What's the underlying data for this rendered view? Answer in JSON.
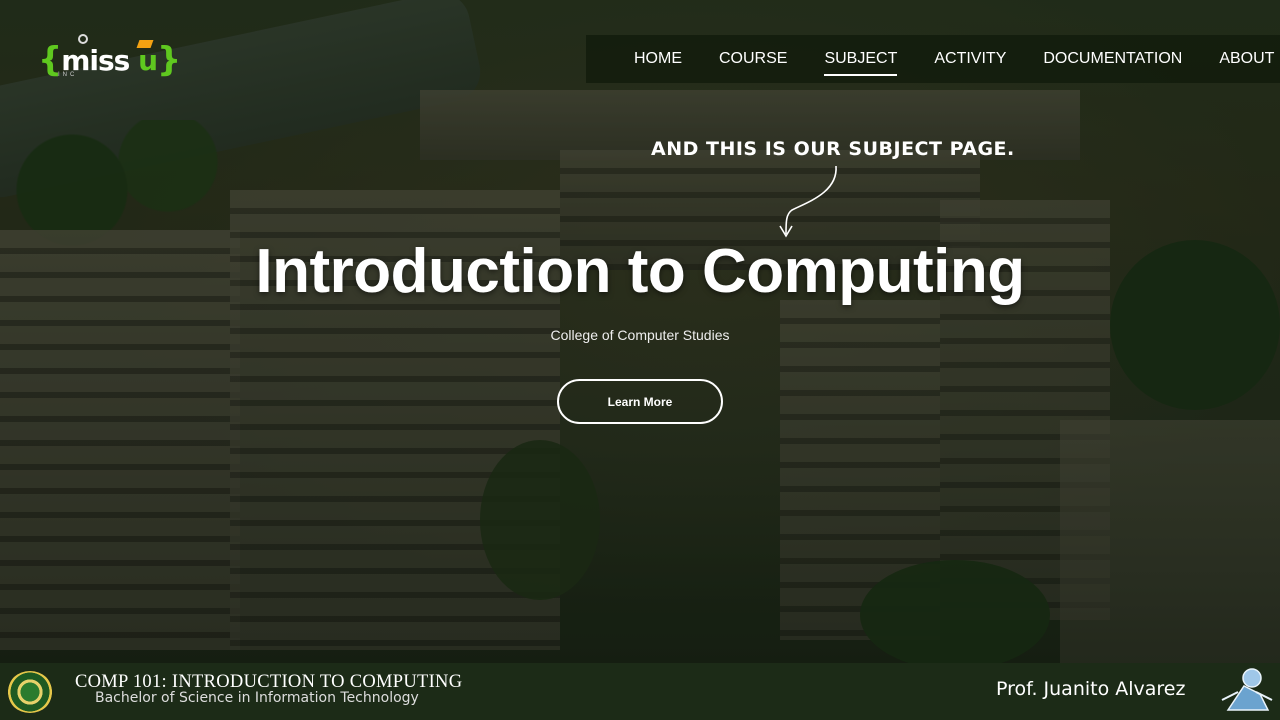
{
  "logo": {
    "brand": "miss u",
    "sub": "INC"
  },
  "nav": {
    "items": [
      "HOME",
      "COURSE",
      "SUBJECT",
      "ACTIVITY",
      "DOCUMENTATION",
      "ABOUT"
    ],
    "active": "SUBJECT"
  },
  "hero": {
    "annotation": "AND THIS IS OUR SUBJECT PAGE.",
    "title": "Introduction to Computing",
    "subtitle": "College of Computer Studies",
    "button_label": "Learn More"
  },
  "footer": {
    "course_title": "COMP 101: INTRODUCTION TO COMPUTING",
    "program": "Bachelor of Science in Information Technology",
    "professor": "Prof. Juanito  Alvarez"
  },
  "colors": {
    "accent_green": "#5fc81f",
    "footer_bg": "#1c2b17",
    "nav_bg": "rgba(15,25,10,0.72)"
  },
  "icons": [
    "gear-icon",
    "graduation-cap-icon",
    "curved-arrow-icon",
    "university-seal-icon",
    "mascot-icon"
  ]
}
